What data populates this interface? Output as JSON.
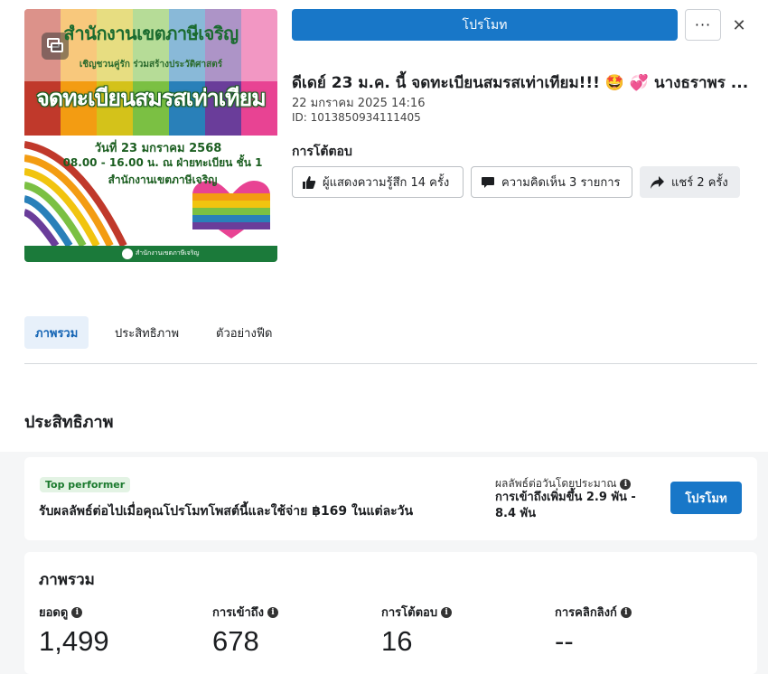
{
  "post": {
    "image_title": "สำนักงานเขตภาษีเจริญ",
    "image_subtitle": "เชิญชวนคู่รัก ร่วมสร้างประวัติศาสตร์",
    "image_headline": "จดทะเบียนสมรสเท่าเทียม",
    "image_date": "วันที่ 23 มกราคม 2568",
    "image_time": "08.00 - 16.00 น. ณ ฝ่ายทะเบียน ชั้น 1",
    "image_office": "สำนักงานเขตภาษีเจริญ",
    "image_footer": "สำนักงานเขตภาษีเจริญ",
    "title": "ดีเดย์ 23 ม.ค. นี้ จดทะเบียนสมรสเท่าเทียม!!! 🤩 💞 นางธราพร ...",
    "date": "22 มกราคม 2025 14:16",
    "id": "ID: 1013850934111405"
  },
  "header": {
    "promote_label": "โปรโมท",
    "more_label": "···",
    "close_label": "✕"
  },
  "engagement": {
    "label": "การโต้ตอบ",
    "reactions": "ผู้แสดงความรู้สึก 14 ครั้ง",
    "comments": "ความคิดเห็น 3 รายการ",
    "shares": "แชร์ 2 ครั้ง"
  },
  "tabs": [
    {
      "label": "ภาพรวม"
    },
    {
      "label": "ประสิทธิภาพ"
    },
    {
      "label": "ตัวอย่างฟีด"
    }
  ],
  "performance": {
    "section_title": "ประสิทธิภาพ",
    "badge": "Top performer",
    "promo_text": "รับผลลัพธ์ต่อไปเมื่อคุณโปรโมทโพสต์นี้และใช้จ่าย ฿169 ในแต่ละวัน",
    "est_label": "ผลลัพธ์ต่อวันโดยประมาณ",
    "est_value": "การเข้าถึงเพิ่มขึ้น 2.9 พัน - 8.4 พัน",
    "promote_label": "โปรโมท"
  },
  "overview": {
    "title": "ภาพรวม",
    "metrics": [
      {
        "label": "ยอดดู",
        "value": "1,499"
      },
      {
        "label": "การเข้าถึง",
        "value": "678"
      },
      {
        "label": "การโต้ตอบ",
        "value": "16"
      },
      {
        "label": "การคลิกลิงก์",
        "value": "--"
      }
    ]
  },
  "colors": {
    "primary": "#1877c8",
    "badge_bg": "#e3f3e4",
    "badge_text": "#1b7a2e",
    "tab_active_bg": "#e7f0fa"
  }
}
